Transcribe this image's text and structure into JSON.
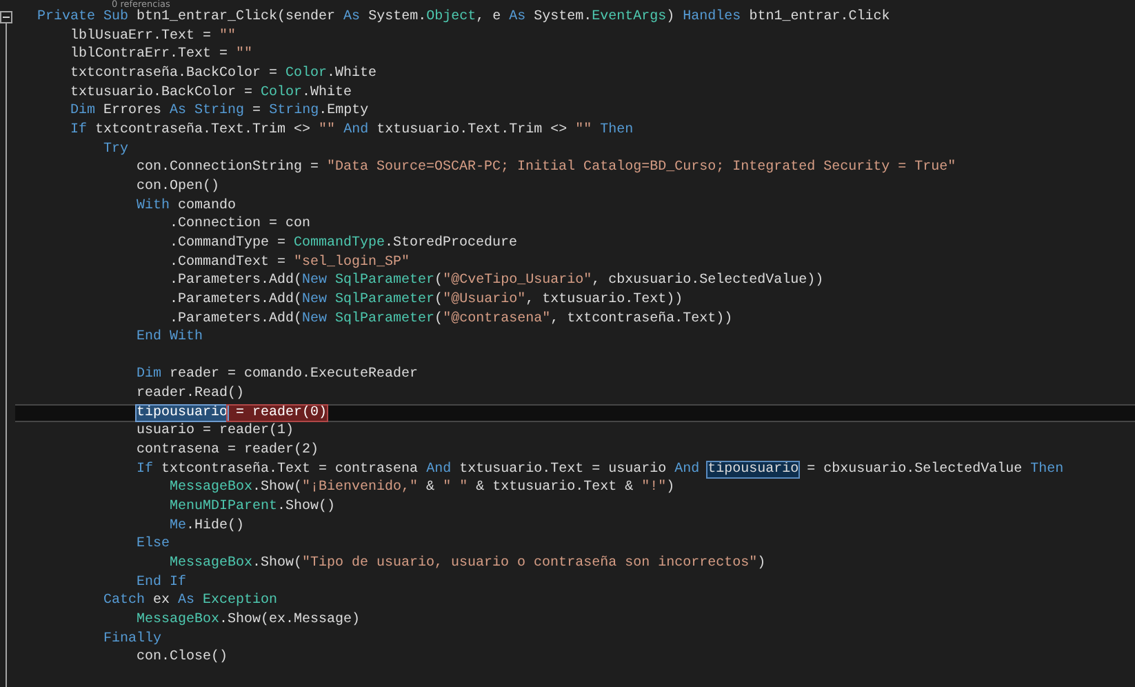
{
  "editor": {
    "codelens": "0 referencias",
    "lines": [
      {
        "tokens": [
          {
            "t": "Private Sub",
            "kind": "kw"
          },
          {
            "t": " btn1_entrar_Click(sender "
          },
          {
            "t": "As",
            "kind": "kw"
          },
          {
            "t": " System."
          },
          {
            "t": "Object",
            "kind": "ty"
          },
          {
            "t": ", e "
          },
          {
            "t": "As",
            "kind": "kw"
          },
          {
            "t": " System."
          },
          {
            "t": "EventArgs",
            "kind": "ty"
          },
          {
            "t": ") "
          },
          {
            "t": "Handles",
            "kind": "kw"
          },
          {
            "t": " btn1_entrar.Click"
          }
        ],
        "children": [
          {
            "tokens": [
              {
                "t": "lblUsuaErr.Text = "
              },
              {
                "t": "\"\"",
                "kind": "str"
              }
            ]
          },
          {
            "tokens": [
              {
                "t": "lblContraErr.Text = "
              },
              {
                "t": "\"\"",
                "kind": "str"
              }
            ]
          },
          {
            "tokens": [
              {
                "t": "txtcontraseña.BackColor = "
              },
              {
                "t": "Color",
                "kind": "ty"
              },
              {
                "t": ".White"
              }
            ]
          },
          {
            "tokens": [
              {
                "t": "txtusuario.BackColor = "
              },
              {
                "t": "Color",
                "kind": "ty"
              },
              {
                "t": ".White"
              }
            ]
          },
          {
            "tokens": [
              {
                "t": "Dim",
                "kind": "kw"
              },
              {
                "t": " Errores "
              },
              {
                "t": "As String",
                "kind": "kw"
              },
              {
                "t": " = "
              },
              {
                "t": "String",
                "kind": "kw"
              },
              {
                "t": ".Empty"
              }
            ]
          },
          {
            "tokens": [
              {
                "t": "If",
                "kind": "kw"
              },
              {
                "t": " txtcontraseña.Text.Trim <> "
              },
              {
                "t": "\"\"",
                "kind": "str"
              },
              {
                "t": " And",
                "kind": "kw"
              },
              {
                "t": " txtusuario.Text.Trim <> "
              },
              {
                "t": "\"\"",
                "kind": "str"
              },
              {
                "t": " Then",
                "kind": "kw"
              }
            ],
            "children": [
              {
                "tokens": [
                  {
                    "t": "Try",
                    "kind": "kw"
                  }
                ],
                "children": [
                  {
                    "tokens": [
                      {
                        "t": "con.ConnectionString = "
                      },
                      {
                        "t": "\"Data Source=OSCAR-PC; Initial Catalog=BD_Curso; Integrated Security = True\"",
                        "kind": "str"
                      }
                    ]
                  },
                  {
                    "tokens": [
                      {
                        "t": "con.Open()"
                      }
                    ]
                  },
                  {
                    "tokens": [
                      {
                        "t": "With",
                        "kind": "kw"
                      },
                      {
                        "t": " comando"
                      }
                    ],
                    "children": [
                      {
                        "tokens": [
                          {
                            "t": ".Connection = con"
                          }
                        ]
                      },
                      {
                        "tokens": [
                          {
                            "t": ".CommandType = "
                          },
                          {
                            "t": "CommandType",
                            "kind": "ty"
                          },
                          {
                            "t": ".StoredProcedure"
                          }
                        ]
                      },
                      {
                        "tokens": [
                          {
                            "t": ".CommandText = "
                          },
                          {
                            "t": "\"sel_login_SP\"",
                            "kind": "str"
                          }
                        ]
                      },
                      {
                        "tokens": [
                          {
                            "t": ".Parameters.Add("
                          },
                          {
                            "t": "New",
                            "kind": "kw"
                          },
                          {
                            "t": " SqlParameter",
                            "kind": "ty"
                          },
                          {
                            "t": "("
                          },
                          {
                            "t": "\"@CveTipo_Usuario\"",
                            "kind": "str"
                          },
                          {
                            "t": ", cbxusuario.SelectedValue))"
                          }
                        ]
                      },
                      {
                        "tokens": [
                          {
                            "t": ".Parameters.Add("
                          },
                          {
                            "t": "New",
                            "kind": "kw"
                          },
                          {
                            "t": " SqlParameter",
                            "kind": "ty"
                          },
                          {
                            "t": "("
                          },
                          {
                            "t": "\"@Usuario\"",
                            "kind": "str"
                          },
                          {
                            "t": ", txtusuario.Text))"
                          }
                        ]
                      },
                      {
                        "tokens": [
                          {
                            "t": ".Parameters.Add("
                          },
                          {
                            "t": "New",
                            "kind": "kw"
                          },
                          {
                            "t": " SqlParameter",
                            "kind": "ty"
                          },
                          {
                            "t": "("
                          },
                          {
                            "t": "\"@contrasena\"",
                            "kind": "str"
                          },
                          {
                            "t": ", txtcontraseña.Text))"
                          }
                        ]
                      }
                    ]
                  },
                  {
                    "tokens": [
                      {
                        "t": "End With",
                        "kind": "kw"
                      }
                    ]
                  },
                  {
                    "gap_before": true,
                    "tokens": [
                      {
                        "t": "Dim",
                        "kind": "kw"
                      },
                      {
                        "t": " reader = comando.ExecuteReader"
                      }
                    ]
                  },
                  {
                    "tokens": [
                      {
                        "t": "reader.Read()"
                      }
                    ]
                  },
                  {
                    "current": true,
                    "tokens": [
                      {
                        "t": "tipousuario",
                        "kind": "selected"
                      },
                      {
                        "t": " = reader(0)",
                        "kind": "error"
                      }
                    ]
                  },
                  {
                    "tokens": [
                      {
                        "t": "usuario = reader(1)"
                      }
                    ]
                  },
                  {
                    "tokens": [
                      {
                        "t": "contrasena = reader(2)"
                      }
                    ]
                  },
                  {
                    "tokens": [
                      {
                        "t": "If",
                        "kind": "kw"
                      },
                      {
                        "t": " txtcontraseña.Text = contrasena "
                      },
                      {
                        "t": "And",
                        "kind": "kw"
                      },
                      {
                        "t": " txtusuario.Text = usuario "
                      },
                      {
                        "t": "And ",
                        "kind": "kw"
                      },
                      {
                        "t": "tipousuario",
                        "kind": "reference"
                      },
                      {
                        "t": " = cbxusuario.SelectedValue "
                      },
                      {
                        "t": "Then",
                        "kind": "kw"
                      }
                    ],
                    "children": [
                      {
                        "tokens": [
                          {
                            "t": "MessageBox",
                            "kind": "ty"
                          },
                          {
                            "t": ".Show("
                          },
                          {
                            "t": "\"¡Bienvenido,\"",
                            "kind": "str"
                          },
                          {
                            "t": " & "
                          },
                          {
                            "t": "\" \"",
                            "kind": "str"
                          },
                          {
                            "t": " & txtusuario.Text & "
                          },
                          {
                            "t": "\"!\"",
                            "kind": "str"
                          },
                          {
                            "t": ")"
                          }
                        ]
                      },
                      {
                        "tokens": [
                          {
                            "t": "MenuMDIParent",
                            "kind": "ty"
                          },
                          {
                            "t": ".Show()"
                          }
                        ]
                      },
                      {
                        "tokens": [
                          {
                            "t": "Me",
                            "kind": "kw"
                          },
                          {
                            "t": ".Hide()"
                          }
                        ]
                      }
                    ]
                  },
                  {
                    "tokens": [
                      {
                        "t": "Else",
                        "kind": "kw"
                      }
                    ],
                    "children": [
                      {
                        "tokens": [
                          {
                            "t": "MessageBox",
                            "kind": "ty"
                          },
                          {
                            "t": ".Show("
                          },
                          {
                            "t": "\"Tipo de usuario, usuario o contraseña son incorrectos\"",
                            "kind": "str"
                          },
                          {
                            "t": ")"
                          }
                        ]
                      }
                    ]
                  },
                  {
                    "tokens": [
                      {
                        "t": "End If",
                        "kind": "kw"
                      }
                    ]
                  }
                ]
              },
              {
                "tokens": [
                  {
                    "t": "Catch",
                    "kind": "kw"
                  },
                  {
                    "t": " ex "
                  },
                  {
                    "t": "As",
                    "kind": "kw"
                  },
                  {
                    "t": " Exception",
                    "kind": "ty"
                  }
                ],
                "children": [
                  {
                    "tokens": [
                      {
                        "t": "MessageBox",
                        "kind": "ty"
                      },
                      {
                        "t": ".Show(ex.Message)"
                      }
                    ]
                  }
                ]
              },
              {
                "tokens": [
                  {
                    "t": "Finally",
                    "kind": "kw"
                  }
                ],
                "children": [
                  {
                    "tokens": [
                      {
                        "t": "con.Close()"
                      }
                    ]
                  }
                ]
              }
            ]
          }
        ]
      }
    ]
  }
}
